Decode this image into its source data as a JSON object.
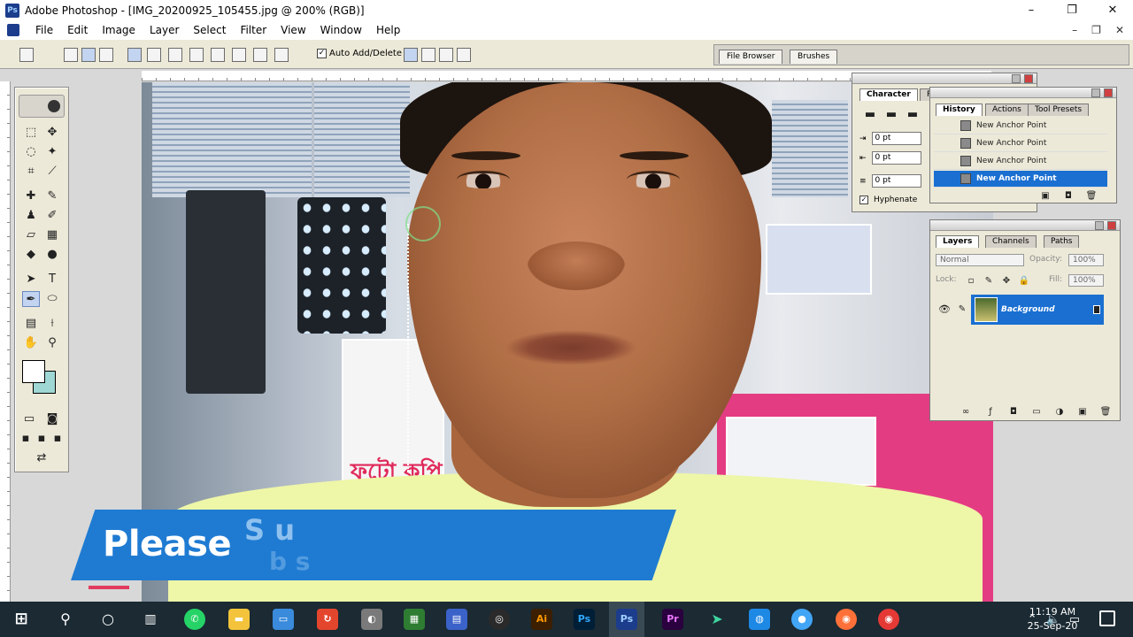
{
  "window": {
    "title": "Adobe Photoshop - [IMG_20200925_105455.jpg @ 200% (RGB)]",
    "controls": [
      "–",
      "❐",
      "✕"
    ],
    "app_icon_letter": "Ps"
  },
  "menubar": {
    "items": [
      "File",
      "Edit",
      "Image",
      "Layer",
      "Select",
      "Filter",
      "View",
      "Window",
      "Help"
    ],
    "mdi_controls": [
      "–",
      "❐",
      "✕"
    ]
  },
  "options_bar": {
    "auto_add_delete_label": "Auto Add/Delete",
    "auto_add_delete_checked": true
  },
  "palette_well": {
    "tabs": [
      "File Browser",
      "Brushes"
    ]
  },
  "character_panel": {
    "tabs": [
      "Character",
      "P"
    ],
    "fields": [
      "0 pt",
      "0 pt",
      "0 pt"
    ],
    "hyphenate_label": "Hyphenate",
    "hyphenate_checked": true
  },
  "history_panel": {
    "tabs": [
      "History",
      "Actions",
      "Tool Presets"
    ],
    "rows": [
      "New Anchor Point",
      "New Anchor Point",
      "New Anchor Point",
      "New Anchor Point"
    ],
    "selected_index": 3
  },
  "layers_panel": {
    "tabs": [
      "Layers",
      "Channels",
      "Paths"
    ],
    "blend_mode": "Normal",
    "opacity_label": "Opacity:",
    "opacity_value": "100%",
    "lock_label": "Lock:",
    "fill_label": "Fill:",
    "fill_value": "100%",
    "layer_name": "Background"
  },
  "canvas": {
    "sign_text": "ফটো কপি"
  },
  "banner": {
    "text": "Please",
    "sub_text": "S u",
    "sub_text_2": "b s",
    "color": "#1f7bd2"
  },
  "taskbar": {
    "time": "11:19 AM",
    "date": "25-Sep-20",
    "icons": [
      "windows-start",
      "search",
      "cortana",
      "task-view",
      "whatsapp",
      "file-explorer",
      "app",
      "app",
      "app",
      "app",
      "chrome-like",
      "illustrator",
      "photoshop",
      "photoshop-active",
      "premiere",
      "app",
      "app",
      "app",
      "firefox",
      "chrome"
    ]
  },
  "toolbox": {
    "foreground_color": "#ffffff",
    "background_color": "#9fd7d4"
  }
}
